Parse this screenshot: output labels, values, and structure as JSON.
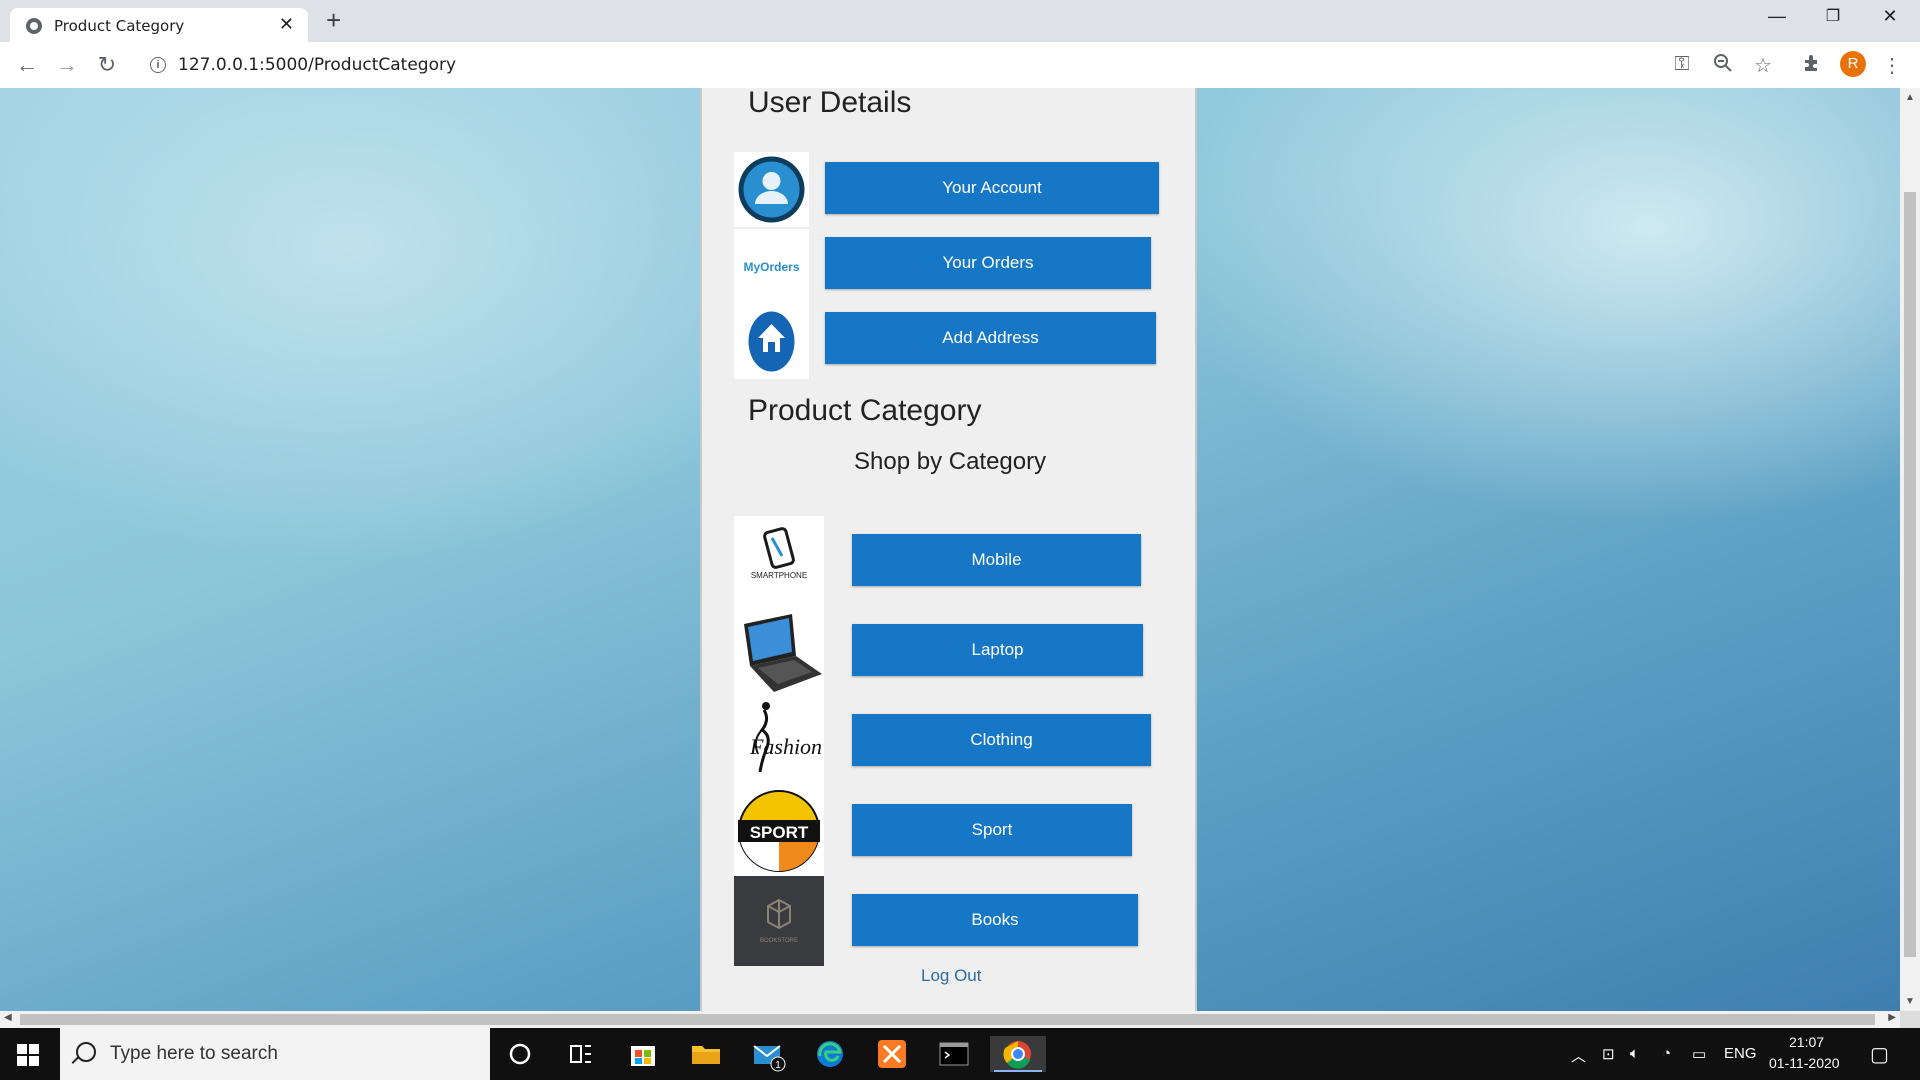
{
  "browser": {
    "tab_title": "Product Category",
    "url": "127.0.0.1:5000/ProductCategory",
    "profile_initial": "R"
  },
  "user_details": {
    "title": "User Details",
    "buttons": [
      {
        "label": "Your Account",
        "icon": "account-icon"
      },
      {
        "label": "Your Orders",
        "icon": "my-orders-icon",
        "icon_text": "MyOrders"
      },
      {
        "label": "Add Address",
        "icon": "home-icon"
      }
    ]
  },
  "product_category": {
    "title": "Product Category",
    "subtitle": "Shop by Category",
    "categories": [
      {
        "label": "Mobile",
        "icon": "smartphone-icon",
        "icon_text": "SMARTPHONE"
      },
      {
        "label": "Laptop",
        "icon": "laptop-icon"
      },
      {
        "label": "Clothing",
        "icon": "fashion-icon",
        "icon_text": "Fashion"
      },
      {
        "label": "Sport",
        "icon": "sport-icon",
        "icon_text": "SPORT"
      },
      {
        "label": "Books",
        "icon": "bookstore-icon",
        "icon_text": "BOOKSTORE"
      }
    ],
    "logout_label": "Log Out"
  },
  "taskbar": {
    "search_placeholder": "Type here to search",
    "language": "ENG",
    "time": "21:07",
    "date": "01-11-2020",
    "mail_badge": "1"
  },
  "colors": {
    "button_blue": "#1577c6",
    "panel_bg": "#efefef",
    "link_blue": "#2e6da4"
  }
}
